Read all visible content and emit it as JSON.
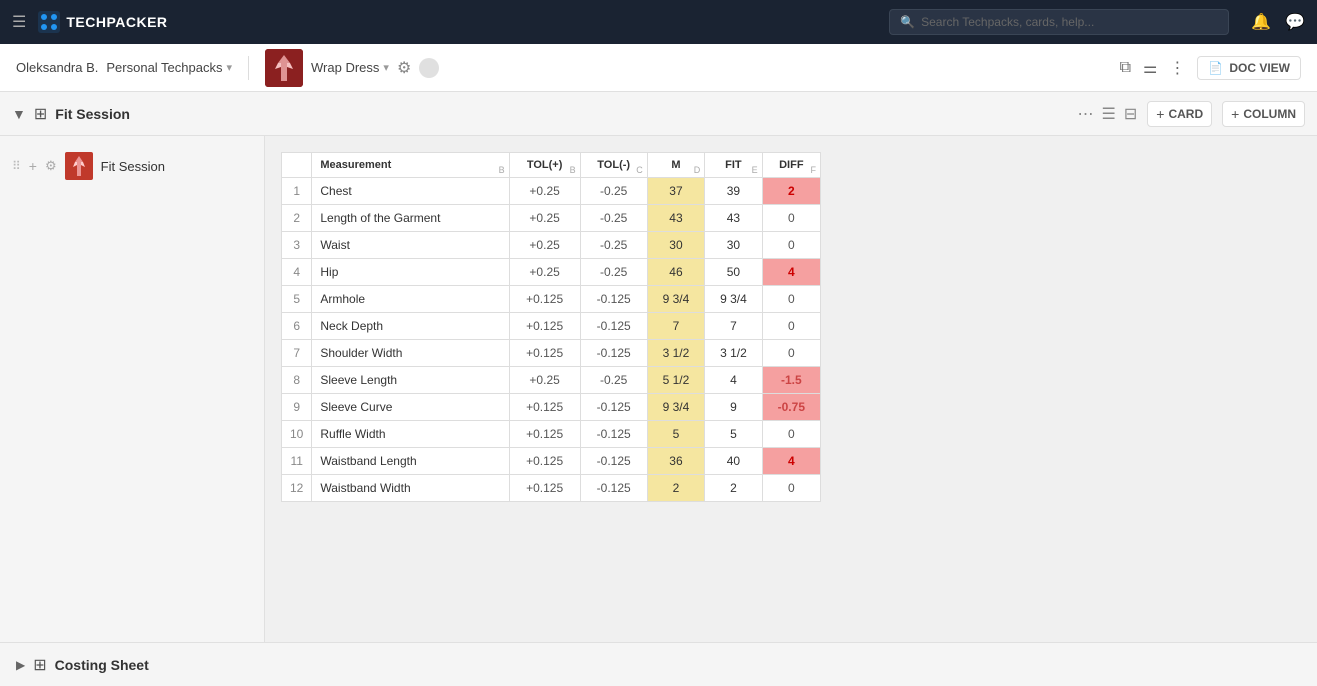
{
  "app": {
    "name": "TECHPACKER",
    "search_placeholder": "Search Techpacks, cards, help...",
    "logo_emoji": "🧊"
  },
  "breadcrumb": {
    "user": "Oleksandra B.",
    "section": "Personal Techpacks",
    "techpack_name": "Wrap Dress",
    "doc_view_label": "DOC VIEW",
    "techpack_emoji": "👗"
  },
  "section": {
    "title": "Fit Session",
    "icon": "⊞",
    "add_card_label": "CARD",
    "add_column_label": "COLUMN"
  },
  "sidebar": {
    "items": [
      {
        "label": "Fit Session",
        "emoji": "👗"
      }
    ]
  },
  "table": {
    "columns": [
      {
        "label": "",
        "letter": ""
      },
      {
        "label": "#",
        "letter": ""
      },
      {
        "label": "Measurement",
        "letter": "B"
      },
      {
        "label": "TOL(+)",
        "letter": "B"
      },
      {
        "label": "TOL(-)",
        "letter": "C"
      },
      {
        "label": "M",
        "letter": "D"
      },
      {
        "label": "FIT",
        "letter": "E"
      },
      {
        "label": "DIFF",
        "letter": "F"
      }
    ],
    "rows": [
      {
        "num": 1,
        "measurement": "Chest",
        "tol_plus": "+0.25",
        "tol_minus": "-0.25",
        "m": "37",
        "fit": "39",
        "diff": "2",
        "diff_class": "diff-pink"
      },
      {
        "num": 2,
        "measurement": "Length of the Garment",
        "tol_plus": "+0.25",
        "tol_minus": "-0.25",
        "m": "43",
        "fit": "43",
        "diff": "0",
        "diff_class": "diff-neutral"
      },
      {
        "num": 3,
        "measurement": "Waist",
        "tol_plus": "+0.25",
        "tol_minus": "-0.25",
        "m": "30",
        "fit": "30",
        "diff": "0",
        "diff_class": "diff-neutral"
      },
      {
        "num": 4,
        "measurement": "Hip",
        "tol_plus": "+0.25",
        "tol_minus": "-0.25",
        "m": "46",
        "fit": "50",
        "diff": "4",
        "diff_class": "diff-pink"
      },
      {
        "num": 5,
        "measurement": "Armhole",
        "tol_plus": "+0.125",
        "tol_minus": "-0.125",
        "m": "9 3/4",
        "fit": "9 3/4",
        "diff": "0",
        "diff_class": "diff-neutral"
      },
      {
        "num": 6,
        "measurement": "Neck Depth",
        "tol_plus": "+0.125",
        "tol_minus": "-0.125",
        "m": "7",
        "fit": "7",
        "diff": "0",
        "diff_class": "diff-neutral"
      },
      {
        "num": 7,
        "measurement": "Shoulder Width",
        "tol_plus": "+0.125",
        "tol_minus": "-0.125",
        "m": "3 1/2",
        "fit": "3 1/2",
        "diff": "0",
        "diff_class": "diff-neutral"
      },
      {
        "num": 8,
        "measurement": "Sleeve Length",
        "tol_plus": "+0.25",
        "tol_minus": "-0.25",
        "m": "5 1/2",
        "fit": "4",
        "diff": "-1.5",
        "diff_class": "diff-peach"
      },
      {
        "num": 9,
        "measurement": "Sleeve Curve",
        "tol_plus": "+0.125",
        "tol_minus": "-0.125",
        "m": "9 3/4",
        "fit": "9",
        "diff": "-0.75",
        "diff_class": "diff-peach"
      },
      {
        "num": 10,
        "measurement": "Ruffle Width",
        "tol_plus": "+0.125",
        "tol_minus": "-0.125",
        "m": "5",
        "fit": "5",
        "diff": "0",
        "diff_class": "diff-neutral"
      },
      {
        "num": 11,
        "measurement": "Waistband Length",
        "tol_plus": "+0.125",
        "tol_minus": "-0.125",
        "m": "36",
        "fit": "40",
        "diff": "4",
        "diff_class": "diff-pink"
      },
      {
        "num": 12,
        "measurement": "Waistband Width",
        "tol_plus": "+0.125",
        "tol_minus": "-0.125",
        "m": "2",
        "fit": "2",
        "diff": "0",
        "diff_class": "diff-neutral"
      }
    ]
  },
  "bottom": {
    "title": "Costing Sheet"
  }
}
